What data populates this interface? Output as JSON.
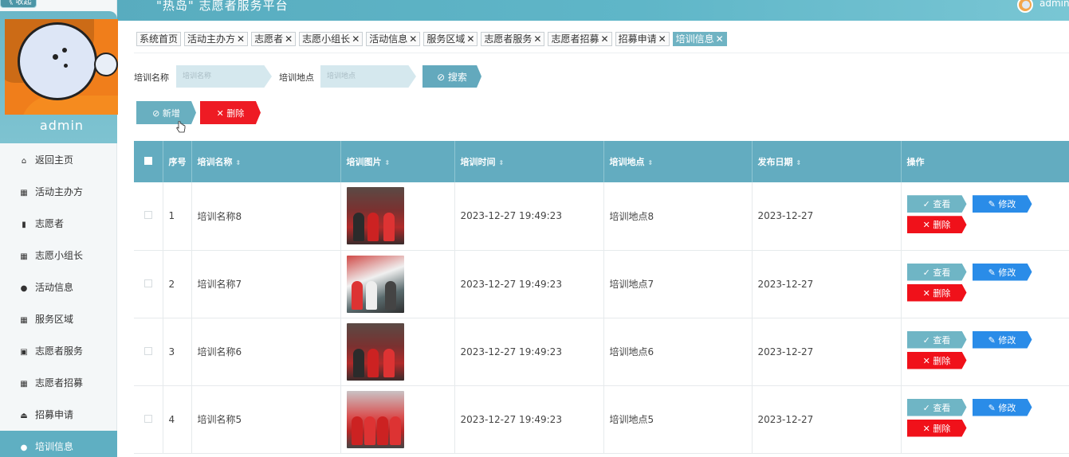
{
  "header": {
    "collapse_label": "《 收起",
    "title": "\"热岛\" 志愿者服务平台",
    "user": "admin"
  },
  "sidebar": {
    "profile_name": "admin",
    "items": [
      {
        "label": "返回主页",
        "icon": "home-icon"
      },
      {
        "label": "活动主办方",
        "icon": "grid-icon"
      },
      {
        "label": "志愿者",
        "icon": "chart-icon"
      },
      {
        "label": "志愿小组长",
        "icon": "grid-icon"
      },
      {
        "label": "活动信息",
        "icon": "pin-icon"
      },
      {
        "label": "服务区域",
        "icon": "grid-icon"
      },
      {
        "label": "志愿者服务",
        "icon": "apps-icon"
      },
      {
        "label": "志愿者招募",
        "icon": "grid-icon"
      },
      {
        "label": "招募申请",
        "icon": "lock-icon"
      },
      {
        "label": "培训信息",
        "icon": "user-icon"
      }
    ],
    "active_index": 9
  },
  "tabs": {
    "home": "系统首页",
    "items": [
      "活动主办方",
      "志愿者",
      "志愿小组长",
      "活动信息",
      "服务区域",
      "志愿者服务",
      "志愿者招募",
      "招募申请",
      "培训信息"
    ],
    "close_glyph": "✕"
  },
  "search": {
    "name_label": "培训名称",
    "name_placeholder": "培训名称",
    "location_label": "培训地点",
    "location_placeholder": "培训地点",
    "button": "⊘ 搜索"
  },
  "actions": {
    "add": "⊘ 新增",
    "delete": "✕ 删除"
  },
  "table": {
    "columns": [
      "序号",
      "培训名称",
      "培训图片",
      "培训时间",
      "培训地点",
      "发布日期",
      "操作"
    ],
    "sort_glyph": "⇕",
    "rows": [
      {
        "index": "1",
        "name": "培训名称8",
        "time": "2023-12-27 19:49:23",
        "location": "培训地点8",
        "date": "2023-12-27",
        "image": "a"
      },
      {
        "index": "2",
        "name": "培训名称7",
        "time": "2023-12-27 19:49:23",
        "location": "培训地点7",
        "date": "2023-12-27",
        "image": "b"
      },
      {
        "index": "3",
        "name": "培训名称6",
        "time": "2023-12-27 19:49:23",
        "location": "培训地点6",
        "date": "2023-12-27",
        "image": "a"
      },
      {
        "index": "4",
        "name": "培训名称5",
        "time": "2023-12-27 19:49:23",
        "location": "培训地点5",
        "date": "2023-12-27",
        "image": "c"
      }
    ],
    "ops": {
      "view": "✓ 查看",
      "edit": "✎ 修改",
      "delete": "✕ 删除"
    }
  },
  "colors": {
    "accent": "#63acc0",
    "danger": "#ee1b24",
    "edit_blue": "#2a8ce8"
  }
}
